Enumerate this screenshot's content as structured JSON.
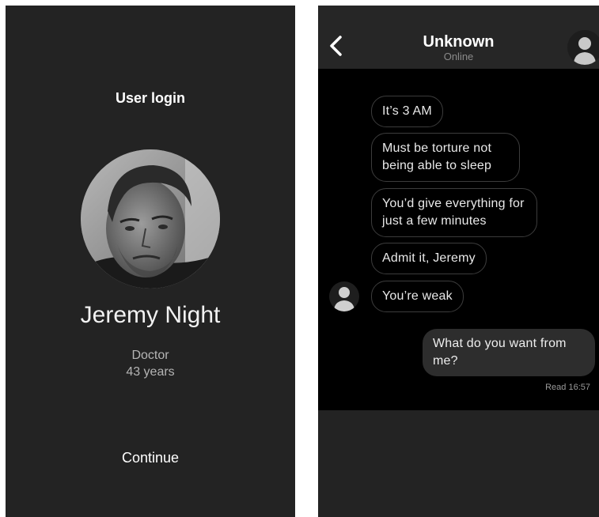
{
  "login": {
    "title": "User login",
    "name": "Jeremy Night",
    "occupation": "Doctor",
    "age": "43 years",
    "continue_label": "Continue"
  },
  "chat": {
    "contact_name": "Unknown",
    "status": "Online",
    "messages": [
      {
        "direction": "incoming",
        "text": "It’s 3 AM"
      },
      {
        "direction": "incoming",
        "text": "Must be torture not being able to sleep"
      },
      {
        "direction": "incoming",
        "text": "You’d give everything for just a few minutes"
      },
      {
        "direction": "incoming",
        "text": "Admit it, Jeremy"
      },
      {
        "direction": "incoming",
        "text": "You’re weak"
      },
      {
        "direction": "outgoing",
        "text": "What do you want from me?"
      }
    ],
    "read_receipt": "Read 16:57"
  },
  "icons": {
    "back": "chevron-left-icon",
    "avatar_placeholder": "person-silhouette-icon"
  },
  "colors": {
    "screen_bg": "#232323",
    "messages_bg": "#000000",
    "outgoing_bubble": "#2d2d2d",
    "incoming_border": "#3c3c3c",
    "muted_text": "#b5b5b5"
  }
}
